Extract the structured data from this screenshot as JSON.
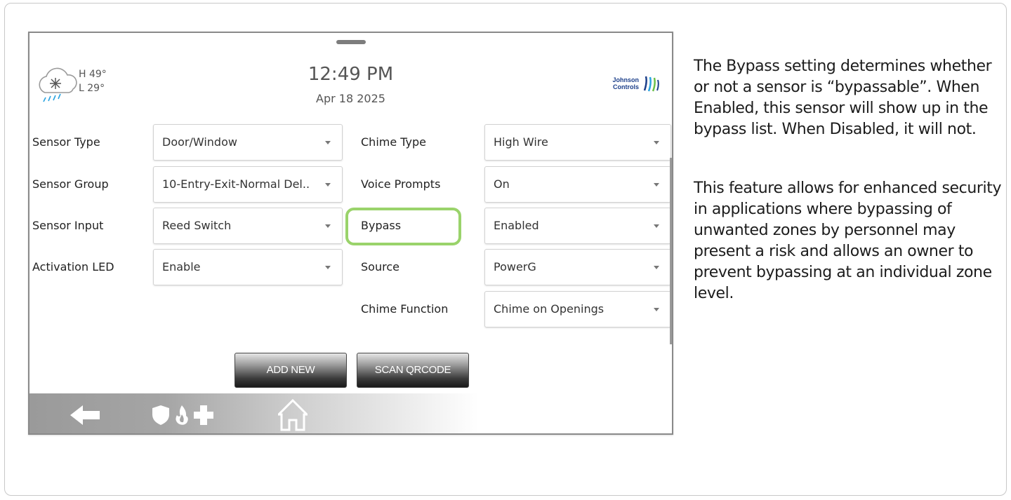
{
  "weather": {
    "high": "H 49°",
    "low": "L 29°",
    "icon": "snow-rain-cloud-icon"
  },
  "clock": {
    "time": "12:49 PM",
    "date": "Apr 18 2025"
  },
  "brand": {
    "line1": "Johnson",
    "line2": "Controls",
    "icon": "johnson-controls-logo"
  },
  "form_left": [
    {
      "label": "Sensor Type",
      "value": "Door/Window"
    },
    {
      "label": "Sensor Group",
      "value": "10-Entry-Exit-Normal Del.."
    },
    {
      "label": "Sensor Input",
      "value": "Reed Switch"
    },
    {
      "label": "Activation LED",
      "value": "Enable"
    }
  ],
  "form_right": [
    {
      "label": "Chime Type",
      "value": "High Wire"
    },
    {
      "label": "Voice Prompts",
      "value": "On"
    },
    {
      "label": "Bypass",
      "value": "Enabled"
    },
    {
      "label": "Source",
      "value": "PowerG"
    },
    {
      "label": "Chime Function",
      "value": "Chime on Openings"
    }
  ],
  "buttons": {
    "add_new": "ADD NEW",
    "scan_qrcode": "SCAN QRCODE"
  },
  "nav": [
    "back-arrow-icon",
    "shield-icon",
    "fire-icon",
    "medical-cross-icon",
    "home-icon"
  ],
  "info": {
    "paragraph1": "The Bypass setting determines whether or not a sensor is “bypassable”.  When Enabled, this sensor will show up in the bypass list.  When Disabled, it will not.",
    "paragraph2": "This feature allows for enhanced security in applications where bypassing of unwanted zones by personnel may present a risk and allows an owner to prevent bypassing at an individual zone level."
  },
  "colors": {
    "highlight": "#9ad36b",
    "brand": "#1c3f8a",
    "accent_blue": "#29a3e0"
  }
}
